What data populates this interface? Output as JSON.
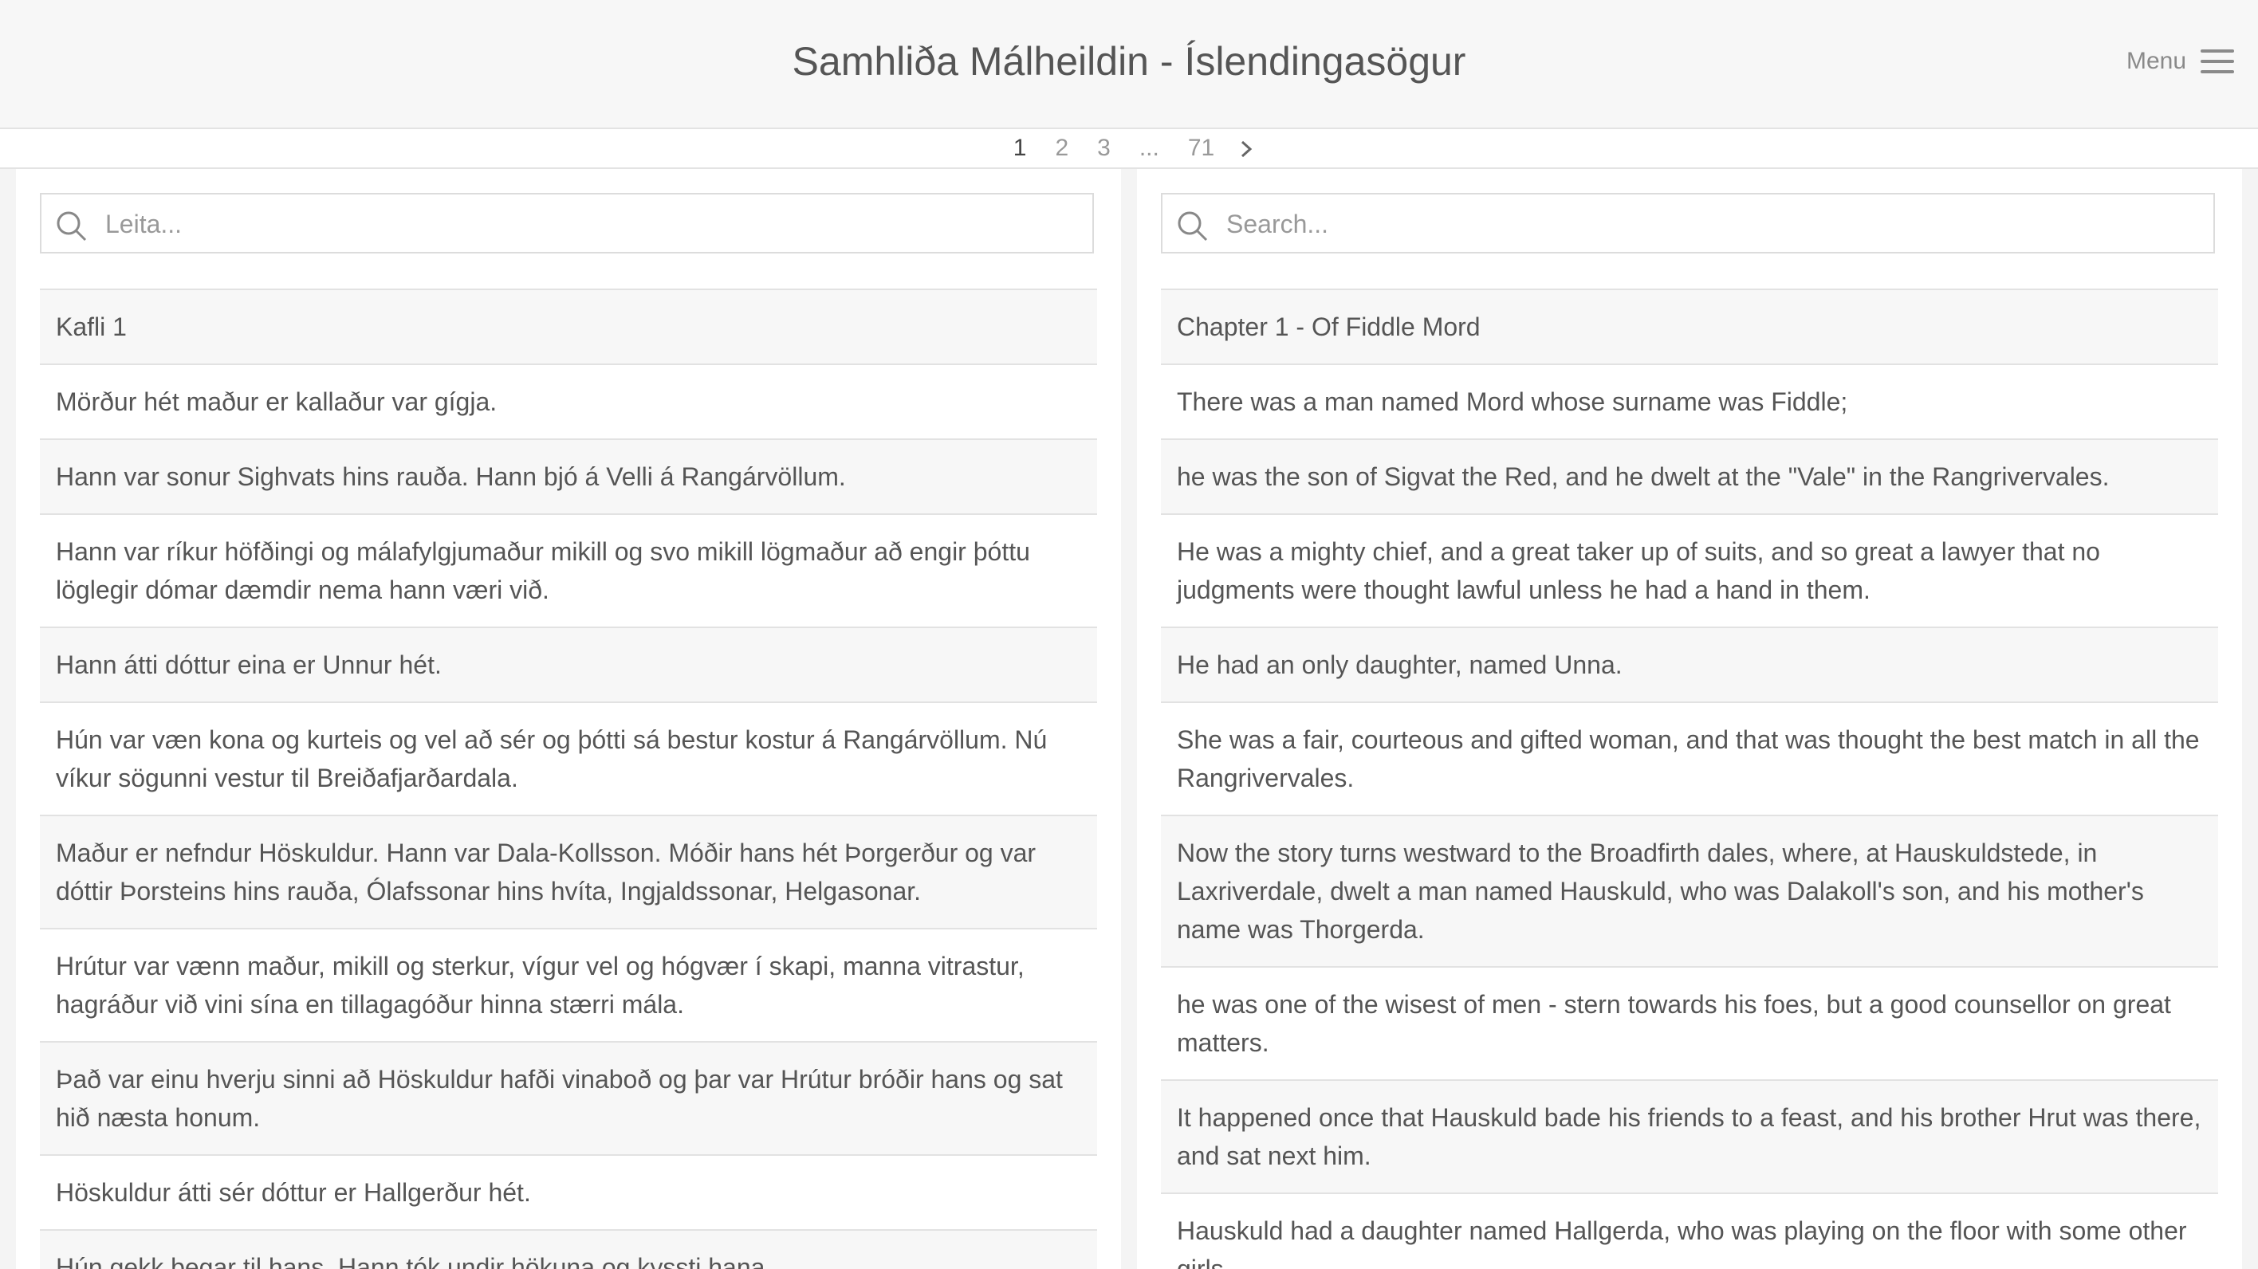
{
  "header": {
    "title": "Samhliða Málheildin - Íslendingasögur",
    "menu_label": "Menu"
  },
  "pagination": {
    "pages": [
      "1",
      "2",
      "3",
      "...",
      "71"
    ],
    "current": "1"
  },
  "left": {
    "search_placeholder": "Leita...",
    "rows": [
      "Kafli 1",
      "Mörður hét maður er kallaður var gígja.",
      "Hann var sonur Sighvats hins rauða. Hann bjó á Velli á Rangárvöllum.",
      "Hann var ríkur höfðingi og málafylgjumaður mikill og svo mikill lögmaður að engir þóttu löglegir dómar dæmdir nema hann væri við.",
      "Hann átti dóttur eina er Unnur hét.",
      "Hún var væn kona og kurteis og vel að sér og þótti sá bestur kostur á Rangárvöllum. Nú víkur sögunni vestur til Breiðafjarðardala.",
      "Maður er nefndur Höskuldur. Hann var Dala-Kollsson. Móðir hans hét Þorgerður og var dóttir Þorsteins hins rauða, Ólafssonar hins hvíta, Ingjaldssonar, Helgasonar.",
      "Hrútur var vænn maður, mikill og sterkur, vígur vel og hógvær í skapi, manna vitrastur, hagráður við vini sína en tillagagóður hinna stærri mála.",
      "Það var einu hverju sinni að Höskuldur hafði vinaboð og þar var Hrútur bróðir hans og sat hið næsta honum.",
      "Höskuldur átti sér dóttur er Hallgerður hét.",
      "Hún gekk þegar til hans. Hann tók undir hökuna og kyssti hana."
    ]
  },
  "right": {
    "search_placeholder": "Search...",
    "rows": [
      "Chapter 1 - Of Fiddle Mord",
      "There was a man named Mord whose surname was Fiddle;",
      "he was the son of Sigvat the Red, and he dwelt at the \"Vale\" in the Rangrivervales.",
      "He was a mighty chief, and a great taker up of suits, and so great a lawyer that no judgments were thought lawful unless he had a hand in them.",
      "He had an only daughter, named Unna.",
      "She was a fair, courteous and gifted woman, and that was thought the best match in all the Rangrivervales.",
      "Now the story turns westward to the Broadfirth dales, where, at Hauskuldstede, in Laxriverdale, dwelt a man named Hauskuld, who was Dalakoll's son, and his mother's name was Thorgerda.",
      "he was one of the wisest of men - stern towards his foes, but a good counsellor on great matters.",
      "It happened once that Hauskuld bade his friends to a feast, and his brother Hrut was there, and sat next him.",
      "Hauskuld had a daughter named Hallgerda, who was playing on the floor with some other girls."
    ]
  }
}
